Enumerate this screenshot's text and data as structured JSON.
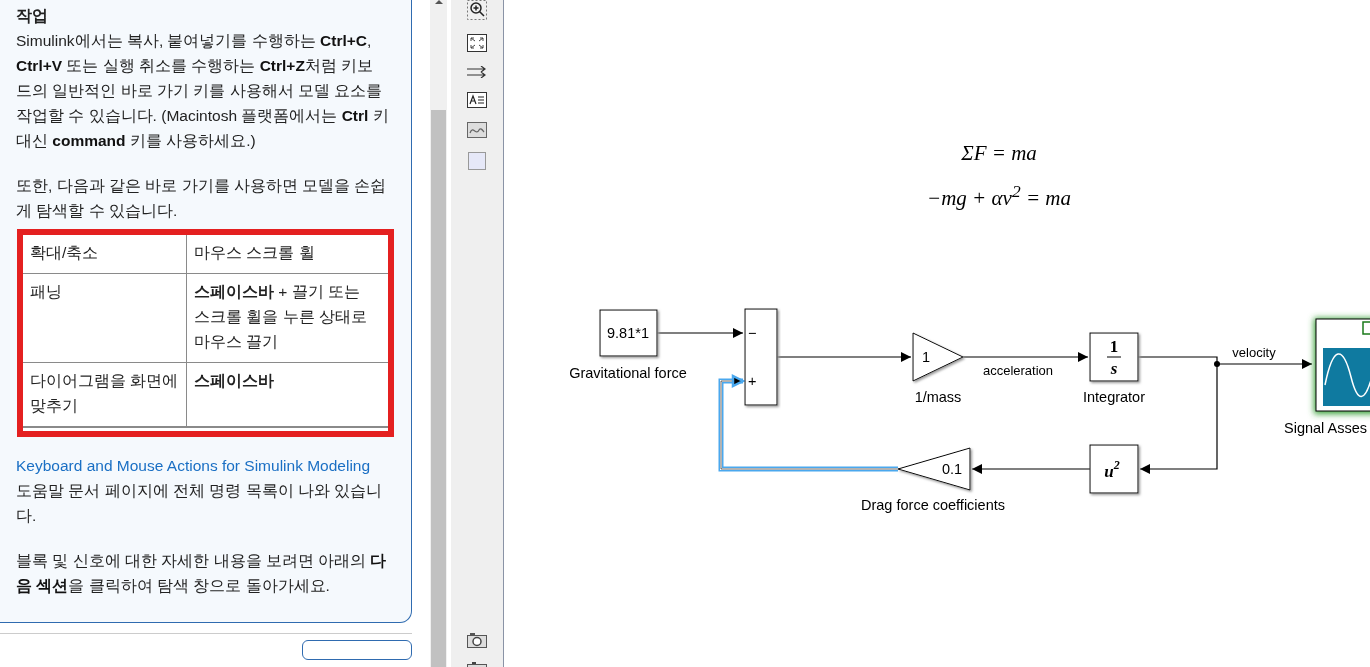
{
  "help_card": {
    "heading": "작업",
    "paragraphs": [
      "Simulink에서는 복사, 붙여넣기를 수행하는 **Ctrl+C**, **Ctrl+V** 또는 실행 취소를 수행하는 **Ctrl+Z**처럼 키보드의 일반적인 바로 가기 키를 사용해서 모델 요소를 작업할 수 있습니다. (Macintosh 플랫폼에서는 **Ctrl** 키 대신 **command** 키를 사용하세요.)",
      "또한, 다음과 같은 바로 가기를 사용하면 모델을 손쉽게 탐색할 수 있습니다."
    ],
    "shortcuts_highlighted": true,
    "shortcuts": [
      {
        "action": "확대/축소",
        "keys": "마우스 스크롤 휠",
        "emphasis": false
      },
      {
        "action": "패닝",
        "keys": "**스페이스바** + 끌기 또는 스크롤 휠을 누른 상태로 마우스 끌기",
        "emphasis": false
      },
      {
        "action": "다이어그램을 화면에 맞추기",
        "keys": "스페이스바",
        "emphasis": true
      }
    ],
    "link": "Keyboard and Mouse Actions for Simulink Modeling",
    "link_after": " 도움말 문서 페이지에 전체 명령 목록이 나와 있습니다.",
    "closing": "블록 및 신호에 대한 자세한 내용을 보려면 아래의 **다음 섹션**을 클릭하여 탐색 창으로 돌아가세요."
  },
  "diagram": {
    "equations": [
      "ΣF = ma",
      "−mg + αv$^{2}$ = ma"
    ],
    "blocks": [
      {
        "kind": "constant",
        "text": "9.81*1",
        "label": "Gravitational force"
      },
      {
        "kind": "sum",
        "signs": [
          "−",
          "+"
        ]
      },
      {
        "kind": "gain",
        "text": "1",
        "label": "1/mass"
      },
      {
        "kind": "integrator",
        "numerator": "1",
        "denominator": "s",
        "label": "Integrator"
      },
      {
        "kind": "gain_reversed",
        "text": "0.1",
        "label": "Drag force coefficients"
      },
      {
        "kind": "math",
        "base": "u",
        "exponent": "2"
      },
      {
        "kind": "assessment",
        "label": "Signal Asses"
      }
    ],
    "signals": [
      {
        "selected": false
      },
      {
        "selected": false
      },
      {
        "label": "acceleration",
        "selected": false
      },
      {
        "label": "velocity",
        "selected": false
      },
      {
        "selected": false
      },
      {
        "selected": false
      },
      {
        "selected": true
      }
    ]
  }
}
